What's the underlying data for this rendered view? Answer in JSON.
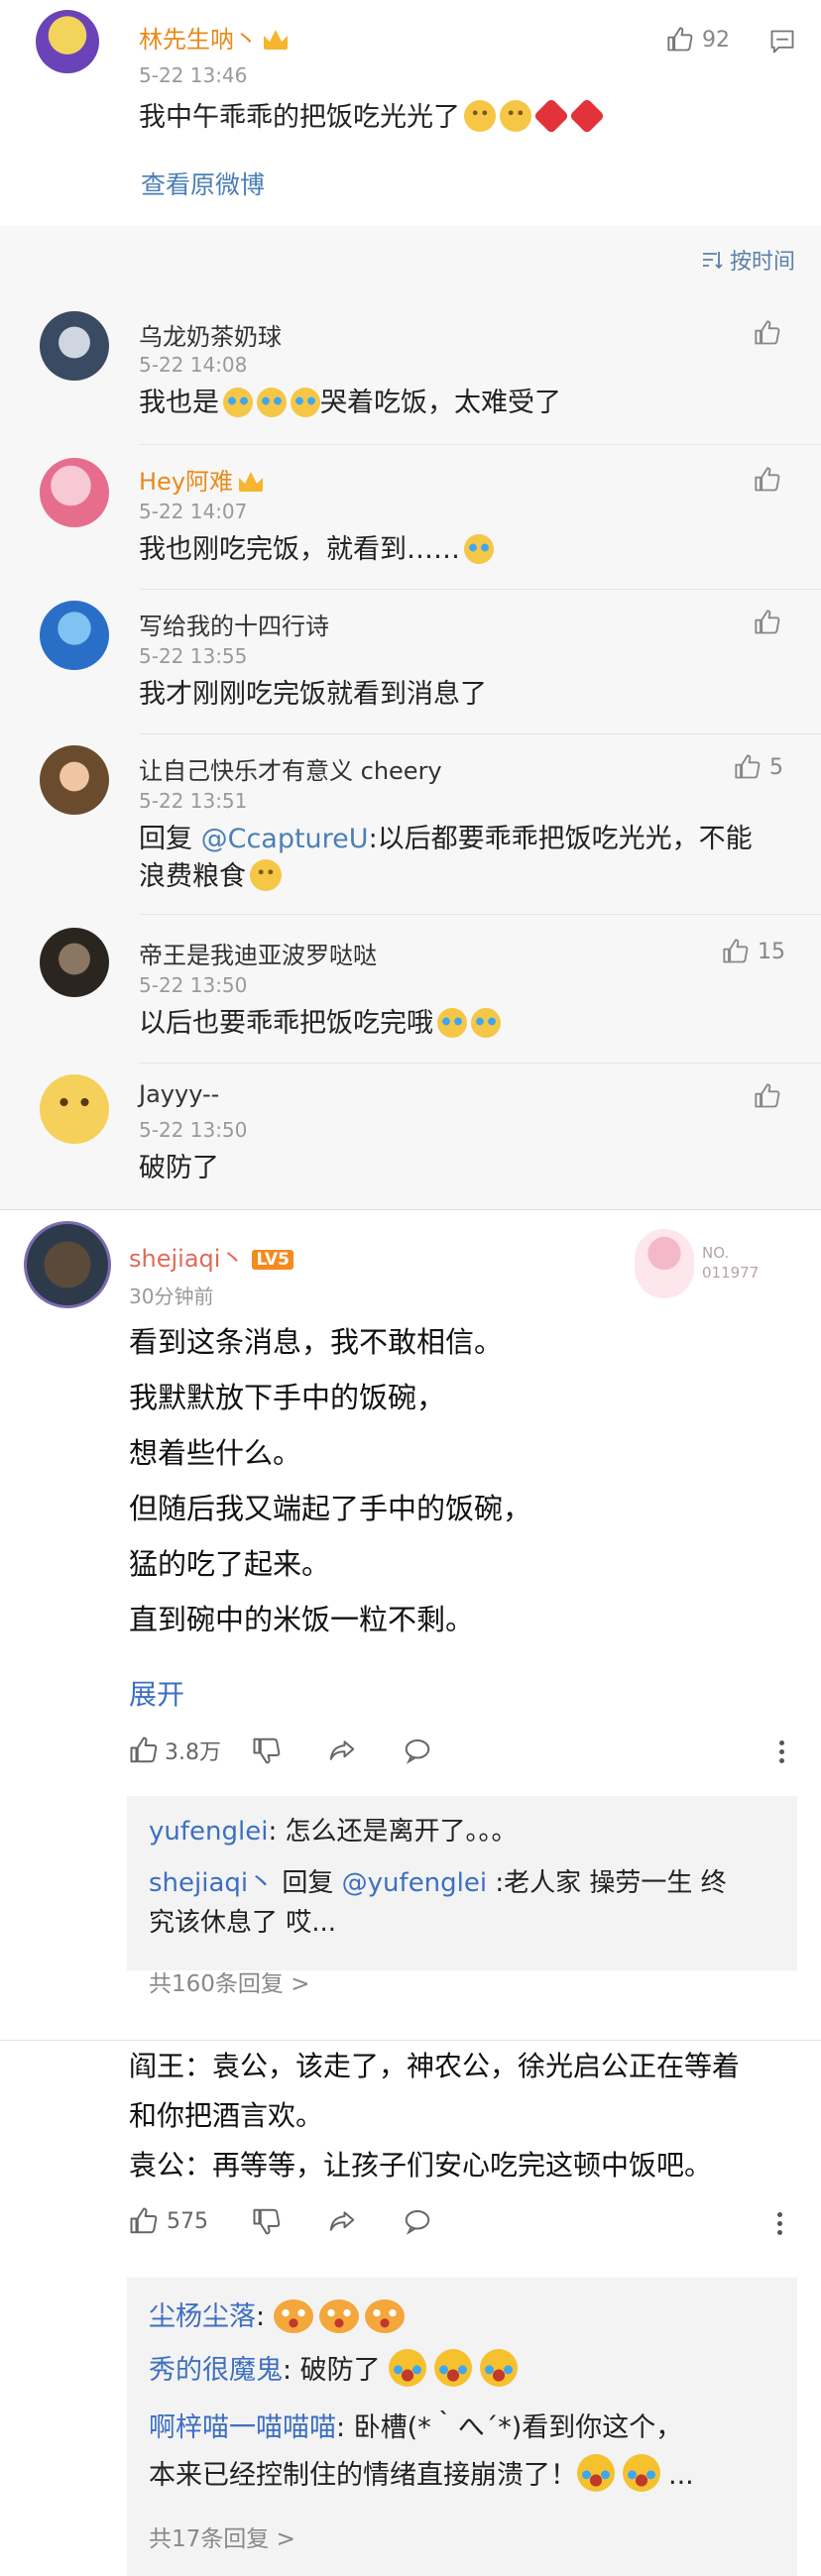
{
  "post": {
    "username": "林先生呐丶",
    "time": "5-22 13:46",
    "text": "我中午乖乖的把饭吃光光了",
    "likes": "92",
    "view_original": "查看原微博"
  },
  "sort_label": "按时间",
  "comments": [
    {
      "user": "乌龙奶茶奶球",
      "time": "5-22 14:08",
      "text_a": "我也是",
      "text_b": "哭着吃饭，太难受了",
      "likes": ""
    },
    {
      "user": "Hey阿难",
      "time": "5-22 14:07",
      "text_a": "我也刚吃完饭，就看到……",
      "likes": ""
    },
    {
      "user": "写给我的十四行诗",
      "time": "5-22 13:55",
      "text_a": "我才刚刚吃完饭就看到消息了",
      "likes": ""
    },
    {
      "user": "让自己快乐才有意义 cheery",
      "time": "5-22 13:51",
      "reply_prefix": "回复 ",
      "mention": "@CcaptureU",
      "text_a": ":以后都要乖乖把饭吃光光，不能",
      "text_b": "浪费粮食",
      "likes": "5"
    },
    {
      "user": "帝王是我迪亚波罗哒哒",
      "time": "5-22 13:50",
      "text_a": "以后也要乖乖把饭吃完哦",
      "likes": "15"
    },
    {
      "user": "Jayyy--",
      "time": "5-22 13:50",
      "text_a": "破防了",
      "likes": ""
    }
  ],
  "thread": {
    "username": "shejiaqi丶",
    "level": "LV5",
    "time": "30分钟前",
    "badge_line1": "NO.",
    "badge_line2": "011977",
    "lines": [
      "看到这条消息，我不敢相信。",
      "我默默放下手中的饭碗，",
      "想着些什么。",
      "但随后我又端起了手中的饭碗，",
      "猛的吃了起来。",
      "直到碗中的米饭一粒不剩。"
    ],
    "expand": "展开",
    "likes": "3.8万",
    "replies": {
      "r1_user": "yufenglei",
      "r1_text": ": 怎么还是离开了。。。",
      "r2_user": "shejiaqi丶",
      "r2_mid": " 回复 ",
      "r2_mention": "@yufenglei",
      "r2_text_a": " :老人家 操劳一生 终",
      "r2_text_b": "究该休息了 哎...",
      "more": "共160条回复 >"
    }
  },
  "thread2": {
    "lines": [
      "阎王：袁公，该走了，神农公，徐光启公正在等着",
      "和你把酒言欢。",
      "袁公：再等等，让孩子们安心吃完这顿中饭吧。"
    ],
    "likes": "575",
    "replies": {
      "r1_user": "尘杨尘落",
      "r1_text": ":",
      "r2_user": "秀的很魔鬼",
      "r2_text": ": 破防了",
      "r3_user": "啊梓喵一喵喵喵",
      "r3_text": ": 卧槽(*｀へ´*)看到你这个，",
      "r3_text_b": "本来已经控制住的情绪直接崩溃了！",
      "r3_ellipsis": "...",
      "more": "共17条回复 >"
    }
  }
}
